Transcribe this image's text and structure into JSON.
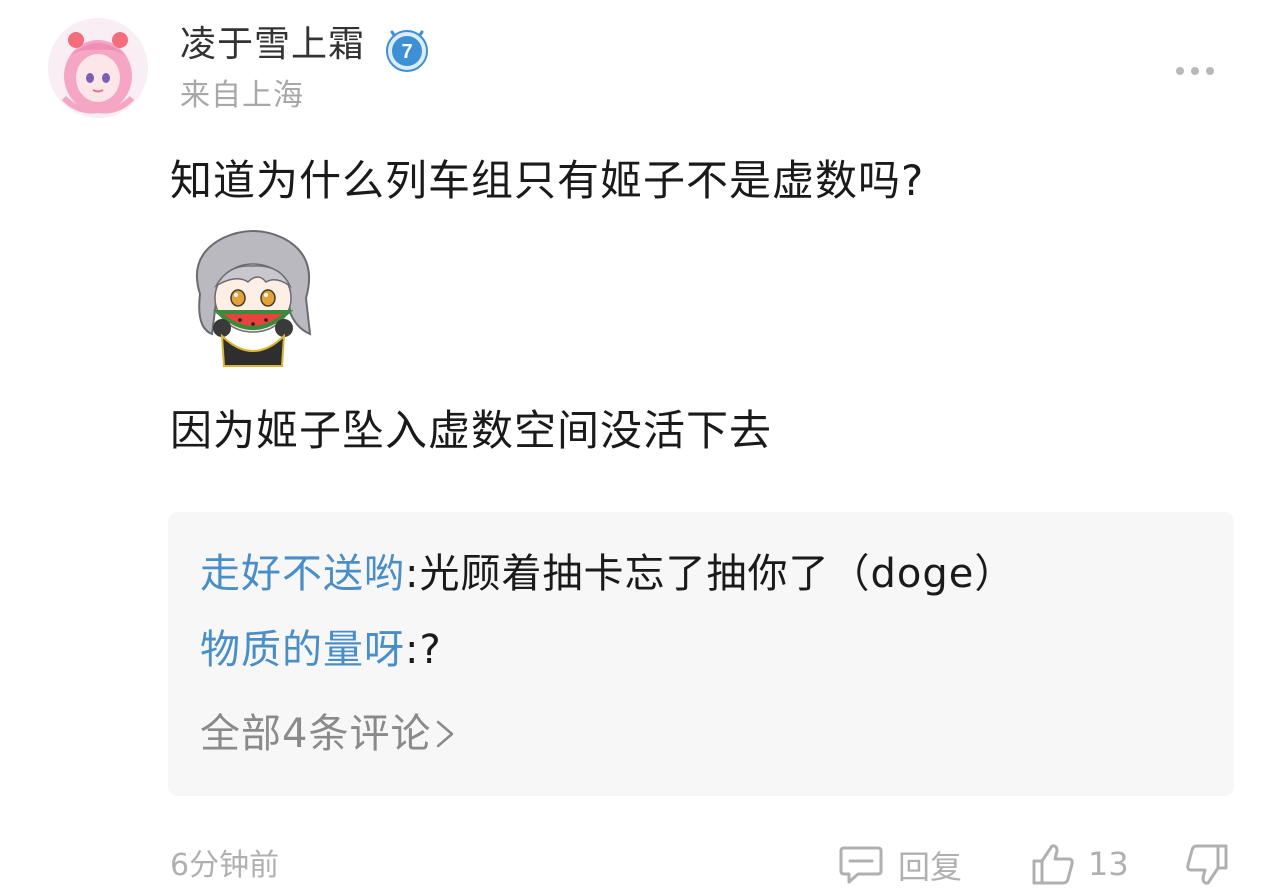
{
  "user": {
    "name": "凌于雪上霜",
    "level": "7",
    "location": "来自上海"
  },
  "post": {
    "line1": "知道为什么列车组只有姬子不是虚数吗?",
    "line2": "因为姬子坠入虚数空间没活下去",
    "sticker_icon": "silver-hair-girl-eating-watermelon-sticker"
  },
  "comments": [
    {
      "author": "走好不送哟",
      "separator": ":",
      "text": "光顾着抽卡忘了抽你了（doge）"
    },
    {
      "author": "物质的量呀",
      "separator": ":",
      "text": "?"
    }
  ],
  "all_comments_label": "全部4条评论",
  "footer": {
    "timestamp": "6分钟前",
    "reply_label": "回复",
    "like_count": "13"
  },
  "colors": {
    "commenter": "#4a8ec7",
    "badge": "#3d8fd6",
    "muted": "#b0b0b0"
  }
}
